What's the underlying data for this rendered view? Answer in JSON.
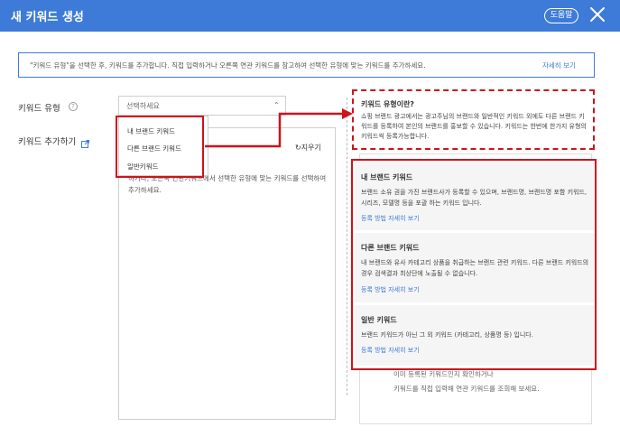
{
  "header": {
    "title": "새 키워드 생성",
    "help_label": "도움말",
    "bg_color": "#3e7bd8"
  },
  "banner": {
    "text": "\"키워드 유형\"을 선택한 후, 키워드를 추가합니다. 직접 입력하거나 오른쪽 연관 키워드를 참고하여 선택한 유형에 맞는 키워드를 추가하세요.",
    "link": "자세히 보기"
  },
  "form": {
    "keyword_type_label": "키워드 유형",
    "keyword_add_label": "키워드 추가하기",
    "select_placeholder": "선택하세요",
    "options": [
      "내 브랜드 키워드",
      "다른 브랜드 키워드",
      "일반키워드"
    ],
    "textarea_hint": ")",
    "clear_label": "지우기",
    "textarea_text": "하거나, 오른쪽 연관키워드에서 선택한 유형에 맞는 키워드를 선택하여 추가하세요."
  },
  "tooltip": {
    "title": "키워드 유형이란?",
    "body": "쇼핑 브랜드 광고에서는 광고주님의 브랜드와 일반적인 키워드 외에도 다른 브랜드 키워드를 등록하여 본인의 브랜드를 홍보할 수 있습니다. 키워드는 한번에 한가지 유형의 키워드씩 등록가능합니다."
  },
  "cards": [
    {
      "title": "내 브랜드 키워드",
      "body": "브랜드 소유 권을 가진 브랜드사가 등록할 수 있으며, 브랜드명, 브랜드명 포함 키워드, 시리즈, 모델명 등을 포괄 하는 키워드 입니다.",
      "link": "등록 방법 자세히 보기"
    },
    {
      "title": "다른 브랜드 키워드",
      "body": "내 브랜드와 유사 카테고리 상품을 취급하는 브랜드 관련 키워드. 다른 브랜드 키워드의 경우 검색결과 최상단에 노출될 수 없습니다.",
      "link": "등록 방법 자세히 보기"
    },
    {
      "title": "일반 키워드",
      "body": "브랜드 키워드가 아닌 그 외 키워드 (카테고리, 상품명 등) 입니다.",
      "link": "등록 방법 자세히 보기"
    }
  ],
  "panel": {
    "line1": "이미 등록된 키워드인지 확인하거나",
    "line2": "키워드를 직접 입력해 연관 키워드를 조회해 보세요."
  },
  "annotation_color": "#d0121b"
}
